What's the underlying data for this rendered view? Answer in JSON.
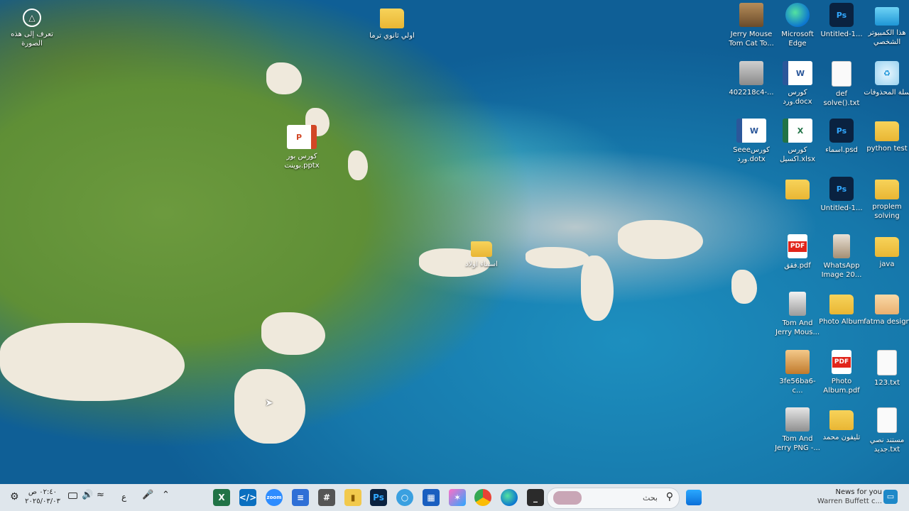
{
  "overlay": {
    "lens_label": "تعرف إلى هذه الصورة"
  },
  "desktop_icons": [
    {
      "label": "اولي ثانوي ترما",
      "icon": "folder-icon"
    },
    {
      "label": "كورس بور بوينت.pptx",
      "icon": "powerpoint-file-icon"
    },
    {
      "label": "اسماء اولاد",
      "icon": "folder-icon"
    },
    {
      "label": "Jerry Mouse Tom Cat To...",
      "icon": "image-file-icon"
    },
    {
      "label": "Microsoft Edge",
      "icon": "edge-icon"
    },
    {
      "label": "Untitled-1...",
      "icon": "photoshop-file-icon"
    },
    {
      "label": "هذا الكمبيوتر الشخصي",
      "icon": "computer-icon"
    },
    {
      "label": "402218c4-...",
      "icon": "image-file-icon"
    },
    {
      "label": "كورس ورد.docx",
      "icon": "word-file-icon"
    },
    {
      "label": "def solve().txt",
      "icon": "text-file-icon"
    },
    {
      "label": "سلة المحذوفات",
      "icon": "recycle-bin-icon"
    },
    {
      "label": "Seeeكورس ورد.dotx",
      "icon": "word-file-icon"
    },
    {
      "label": "كورس اكسيل.xlsx",
      "icon": "excel-file-icon"
    },
    {
      "label": "اسماء.psd",
      "icon": "photoshop-file-icon"
    },
    {
      "label": "python test",
      "icon": "folder-icon"
    },
    {
      "label": "",
      "icon": "folder-icon"
    },
    {
      "label": "Untitled-1...",
      "icon": "photoshop-file-icon"
    },
    {
      "label": "proplem solving",
      "icon": "folder-icon"
    },
    {
      "label": "فقق.pdf",
      "icon": "pdf-file-icon"
    },
    {
      "label": "WhatsApp Image 20...",
      "icon": "image-file-icon"
    },
    {
      "label": "java",
      "icon": "folder-icon"
    },
    {
      "label": "Tom And Jerry Mous...",
      "icon": "image-file-icon"
    },
    {
      "label": "Photo Album",
      "icon": "folder-icon"
    },
    {
      "label": "fatma design",
      "icon": "folder-icon"
    },
    {
      "label": "3fe56ba6-c...",
      "icon": "image-file-icon"
    },
    {
      "label": "Photo Album.pdf",
      "icon": "pdf-file-icon"
    },
    {
      "label": "123.txt",
      "icon": "text-file-icon"
    },
    {
      "label": "Tom And Jerry PNG -...",
      "icon": "image-file-icon"
    },
    {
      "label": "تليفون محمد",
      "icon": "folder-icon"
    },
    {
      "label": "مستند نصي جديد.txt",
      "icon": "text-file-icon"
    }
  ],
  "taskbar": {
    "time": "٠٢:٤٠ ص",
    "date": "٢٠٢٥/٠٣/٠٣",
    "language": "ع",
    "search_placeholder": "بحث",
    "apps": [
      "Excel",
      "Visual Studio Code",
      "Zoom",
      "Notepad",
      "Calculator",
      "File Explorer",
      "Photoshop",
      "Web browser",
      "Microsoft Store",
      "Copilot",
      "Google Chrome",
      "Microsoft Edge",
      "Terminal"
    ],
    "news_title": "News for you",
    "news_subtitle": "Warren Buffett c..."
  },
  "colors": {
    "taskbar_bg": "#dfe6ec",
    "folder": "#f2c94c",
    "photoshop": "#31a8ff",
    "word": "#2b579a",
    "excel": "#217346",
    "pdf": "#e1251b"
  }
}
